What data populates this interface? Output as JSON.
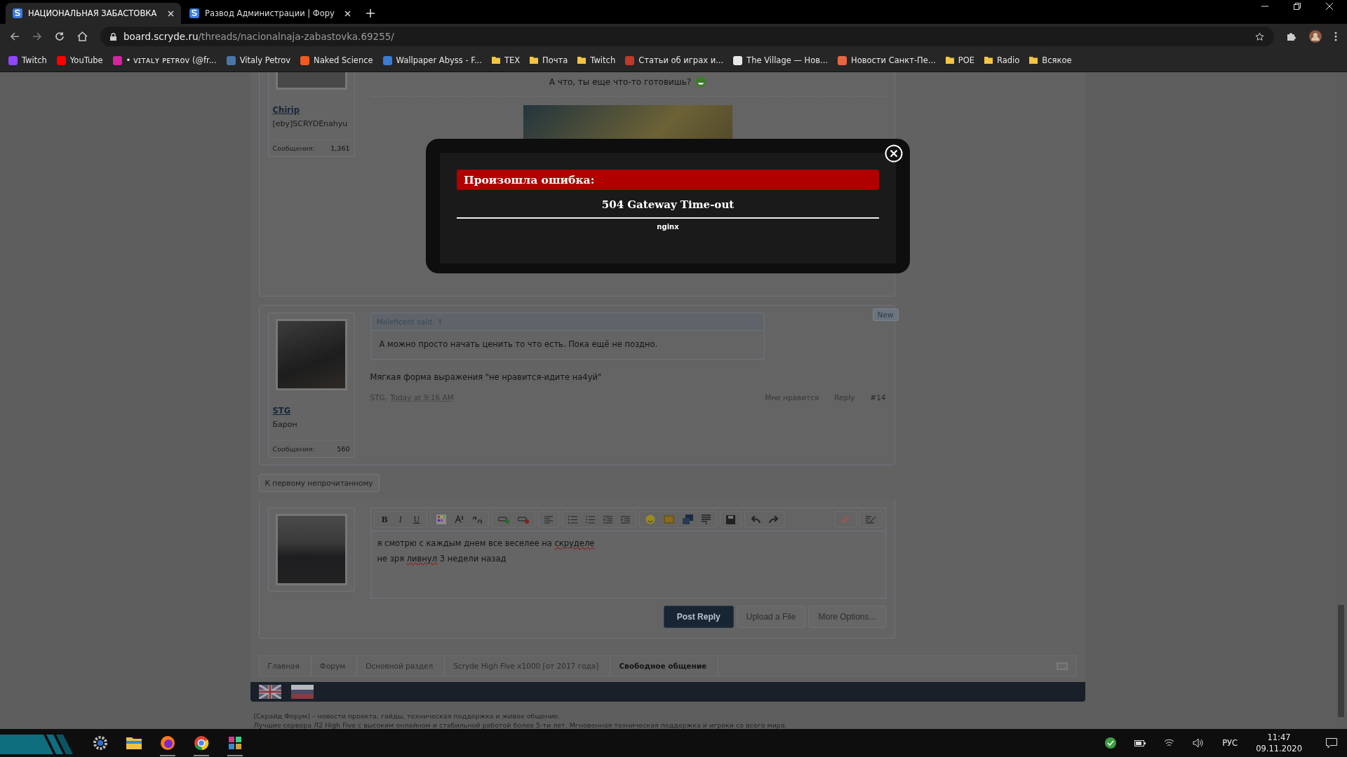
{
  "browser": {
    "tabs": [
      {
        "title": "НАЦИОНАЛЬНАЯ ЗАБАСТОВКА",
        "selected": true
      },
      {
        "title": "Развод Администрации | Фору",
        "selected": false
      }
    ],
    "url": {
      "host": "board.scryde.ru",
      "path": "/threads/nacionalnaja-zabastovka.69255/"
    },
    "bookmarks": [
      {
        "label": "Twitch",
        "kind": "site",
        "color": "#9146ff"
      },
      {
        "label": "YouTube",
        "kind": "site",
        "color": "#ff0000"
      },
      {
        "label": "• ᴠɪᴛᴀʟʏ ᴘᴇᴛʀᴏᴠ (@fr...",
        "kind": "site",
        "color": "#d6249f"
      },
      {
        "label": "Vitaly Petrov",
        "kind": "site",
        "color": "#4a76a8"
      },
      {
        "label": "Naked Science",
        "kind": "site",
        "color": "#f15a22"
      },
      {
        "label": "Wallpaper Abyss - F...",
        "kind": "site",
        "color": "#3a7bd5"
      },
      {
        "label": "TEX",
        "kind": "folder"
      },
      {
        "label": "Почта",
        "kind": "folder"
      },
      {
        "label": "Twitch",
        "kind": "folder"
      },
      {
        "label": "Статьи об играх и...",
        "kind": "site",
        "color": "#c0392b"
      },
      {
        "label": "The Village — Нов...",
        "kind": "site",
        "color": "#e8e8e8"
      },
      {
        "label": "Новости Санкт-Пе...",
        "kind": "site",
        "color": "#e8663d"
      },
      {
        "label": "POE",
        "kind": "folder"
      },
      {
        "label": "Radio",
        "kind": "folder"
      },
      {
        "label": "Всякое",
        "kind": "folder"
      }
    ]
  },
  "posts": [
    {
      "author": "Chirip",
      "user_title": "[eby]SCRYDEnahyu",
      "messages_label": "Сообщения:",
      "messages_count": "1,361",
      "text": "А что, ты еще что-то готовишь?"
    },
    {
      "author": "STG",
      "user_title": "Барон",
      "messages_label": "Сообщения:",
      "messages_count": "560",
      "badge": "New",
      "quote": {
        "attribution": "Maleficent said: ↑",
        "text": "А можно просто начать ценить то что есть. Пока ещё не поздно."
      },
      "text": "Мягкая форма выражения \"не нравится-идите на4уй\"",
      "footer": {
        "author": "STG,",
        "date": "Today at 9:16 AM",
        "like": "Мне нравится",
        "reply": "Reply",
        "number": "#14"
      }
    }
  ],
  "unread_button": "К первому непрочитанному",
  "editor": {
    "format_buttons": [
      "B",
      "I",
      "U"
    ],
    "lines": [
      [
        {
          "text": "я смотрю с каждым днем все веселее на ",
          "misspelled": false
        },
        {
          "text": "скруделе",
          "misspelled": true
        }
      ],
      [
        {
          "text": "не зря ",
          "misspelled": false
        },
        {
          "text": "ливнул",
          "misspelled": true
        },
        {
          "text": " 3 недели назад",
          "misspelled": false
        }
      ]
    ],
    "buttons": [
      {
        "label": "Post Reply",
        "primary": true
      },
      {
        "label": "Upload a File",
        "primary": false
      },
      {
        "label": "More Options...",
        "primary": false
      }
    ]
  },
  "breadcrumbs": [
    {
      "label": "Главная",
      "selected": false
    },
    {
      "label": "Форум",
      "selected": false
    },
    {
      "label": "Основной раздел",
      "selected": false
    },
    {
      "label": "Scryde High Five x1000 [от 2017 года]",
      "selected": false
    },
    {
      "label": "Свободное общение",
      "selected": true
    }
  ],
  "footer_text": [
    "[Скрайд Форум] – новости проекта, гайды, техническая поддержка и живое общение.",
    "Лучшие сервера Л2 High Five с высоким онлайном и стабильной работой более 5-ти лет. Мгновенная техническая поддержка и игроки со всего мира."
  ],
  "error_dialog": {
    "title": "Произошла ошибка:",
    "message": "504 Gateway Time-out",
    "server": "nginx"
  },
  "taskbar": {
    "language": "РУС",
    "time": "11:47",
    "date": "09.11.2020"
  }
}
